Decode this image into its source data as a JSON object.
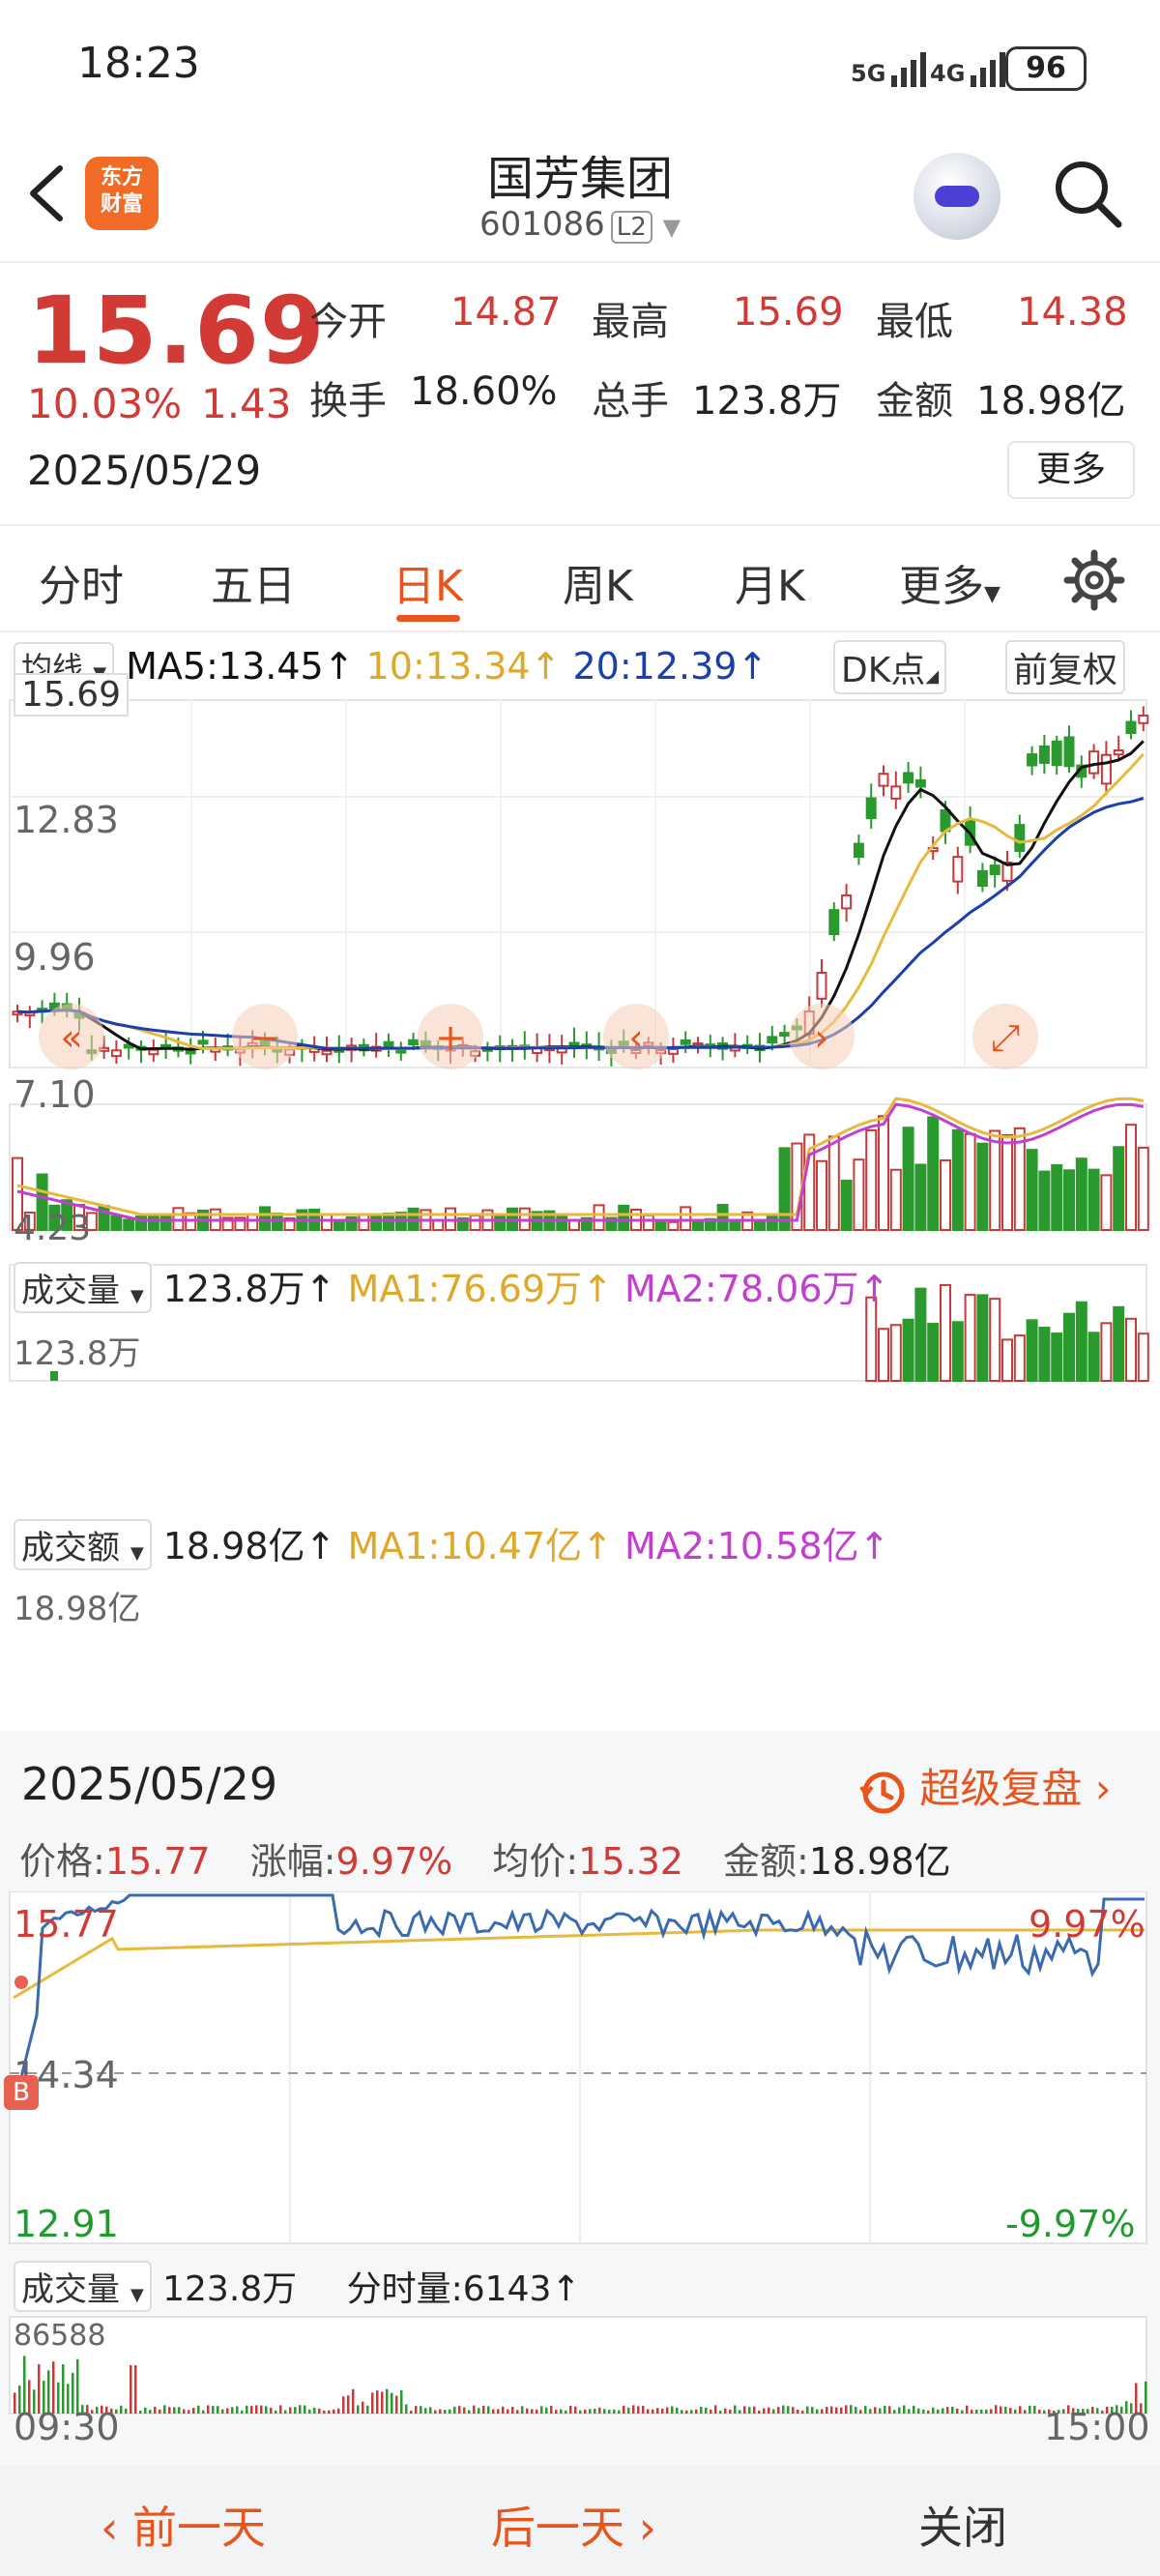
{
  "status_bar": {
    "time": "18:23",
    "signal1": "5G",
    "signal2": "4G",
    "battery": "96"
  },
  "header": {
    "stock_name": "国芳集团",
    "stock_code": "601086",
    "level_badge": "L2",
    "logo_text_1": "东方",
    "logo_text_2": "财富"
  },
  "quote": {
    "price": "15.69",
    "change_pct": "10.03%",
    "change_amt": "1.43",
    "date": "2025/05/29",
    "open_label": "今开",
    "open": "14.87",
    "high_label": "最高",
    "high": "15.69",
    "low_label": "最低",
    "low": "14.38",
    "turnover_label": "换手",
    "turnover": "18.60%",
    "volume_label": "总手",
    "volume": "123.8万",
    "amount_label": "金额",
    "amount": "18.98亿",
    "more_label": "更多"
  },
  "tabs": [
    "分时",
    "五日",
    "日K",
    "周K",
    "月K",
    "更多"
  ],
  "active_tab": "日K",
  "kline": {
    "indicator_label": "均线",
    "ma5": "MA5:13.45↑",
    "ma10": "10:13.34↑",
    "ma20": "20:12.39↑",
    "dk_label": "DK点",
    "adjust_label": "前复权",
    "price_ticks": [
      "15.69",
      "12.83",
      "9.96",
      "7.10",
      "4.23"
    ],
    "colors": {
      "up": "#c8393a",
      "down": "#2a9a2e",
      "ma5": "#111111",
      "ma10": "#e8b93c",
      "ma20": "#1c3fb0"
    }
  },
  "volume_panel": {
    "label": "成交量",
    "value": "123.8万↑",
    "ma1": "MA1:76.69万↑",
    "ma2": "MA2:78.06万↑",
    "max": "123.8万",
    "colors": {
      "ma1": "#e8b93c",
      "ma2": "#c23fd0"
    }
  },
  "amount_panel": {
    "label": "成交额",
    "value": "18.98亿↑",
    "ma1": "MA1:10.47亿↑",
    "ma2": "MA2:10.58亿↑",
    "max": "18.98亿"
  },
  "intraday": {
    "date": "2025/05/29",
    "replay": "超级复盘",
    "price_label": "价格:",
    "price": "15.77",
    "chg_label": "涨幅:",
    "chg": "9.97%",
    "avg_label": "均价:",
    "avg": "15.32",
    "amt_label": "金额:",
    "amt": "18.98亿",
    "top_price": "15.77",
    "mid_price": "14.34",
    "bottom_price": "12.91",
    "top_pct": "9.97%",
    "bottom_pct": "-9.97%",
    "b_marker": "B",
    "vol_label": "成交量",
    "vol_value": "123.8万",
    "tick_vol": "分时量:6143↑",
    "vol_max": "86588",
    "time_start": "09:30",
    "time_end": "15:00"
  },
  "footer": {
    "prev": "前一天",
    "next": "后一天",
    "close": "关闭"
  }
}
